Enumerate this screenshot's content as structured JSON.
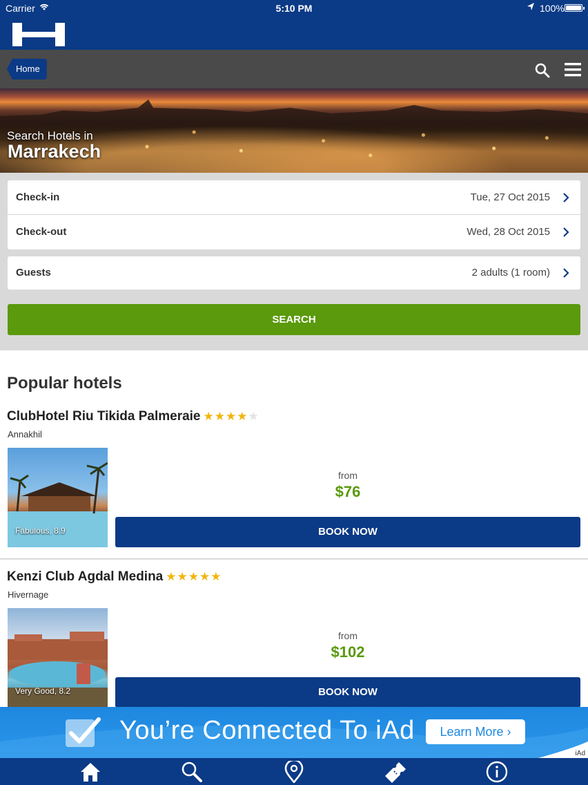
{
  "status_bar": {
    "carrier": "Carrier",
    "time": "5:10 PM",
    "battery": "100%"
  },
  "nav": {
    "home_label": "Home",
    "icons": [
      "search-icon",
      "menu-icon"
    ]
  },
  "hero": {
    "subtitle": "Search Hotels in",
    "city": "Marrakech"
  },
  "search_form": {
    "checkin_label": "Check-in",
    "checkin_value": "Tue, 27 Oct 2015",
    "checkout_label": "Check-out",
    "checkout_value": "Wed, 28 Oct 2015",
    "guests_label": "Guests",
    "guests_value": "2 adults (1 room)",
    "search_label": "SEARCH"
  },
  "popular": {
    "title": "Popular hotels",
    "hotels": [
      {
        "name": "ClubHotel Riu Tikida Palmeraie",
        "stars": 4,
        "area": "Annakhil",
        "rating": "Fabulous, 8.9",
        "from_label": "from",
        "price": "$76",
        "book_label": "BOOK NOW"
      },
      {
        "name": "Kenzi Club Agdal Medina",
        "stars": 5,
        "area": "Hivernage",
        "rating": "Very Good, 8.2",
        "from_label": "from",
        "price": "$102",
        "book_label": "BOOK NOW"
      }
    ]
  },
  "ad": {
    "headline": "You’re Connected To iAd",
    "button": "Learn More ›",
    "tag": "iAd"
  },
  "tab_bar": {
    "tabs": [
      "home-icon",
      "search-icon",
      "location-pin-icon",
      "ticket-icon",
      "info-icon"
    ]
  },
  "colors": {
    "brand_blue": "#0b3a86",
    "accent_green": "#5a9a0c",
    "star_gold": "#f2b50f"
  }
}
